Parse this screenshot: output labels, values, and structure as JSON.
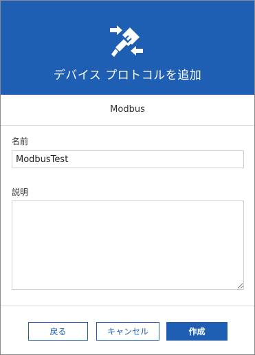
{
  "dialog": {
    "title": "デバイス プロトコルを追加",
    "header_icon": "plug-connect-icon",
    "protocol_name": "Modbus"
  },
  "form": {
    "name_label": "名前",
    "name_value": "ModbusTest",
    "description_label": "説明",
    "description_value": ""
  },
  "buttons": {
    "back_label": "戻る",
    "cancel_label": "キャンセル",
    "create_label": "作成"
  },
  "colors": {
    "brand": "#1f5fb3",
    "header_text": "#ffffff"
  }
}
